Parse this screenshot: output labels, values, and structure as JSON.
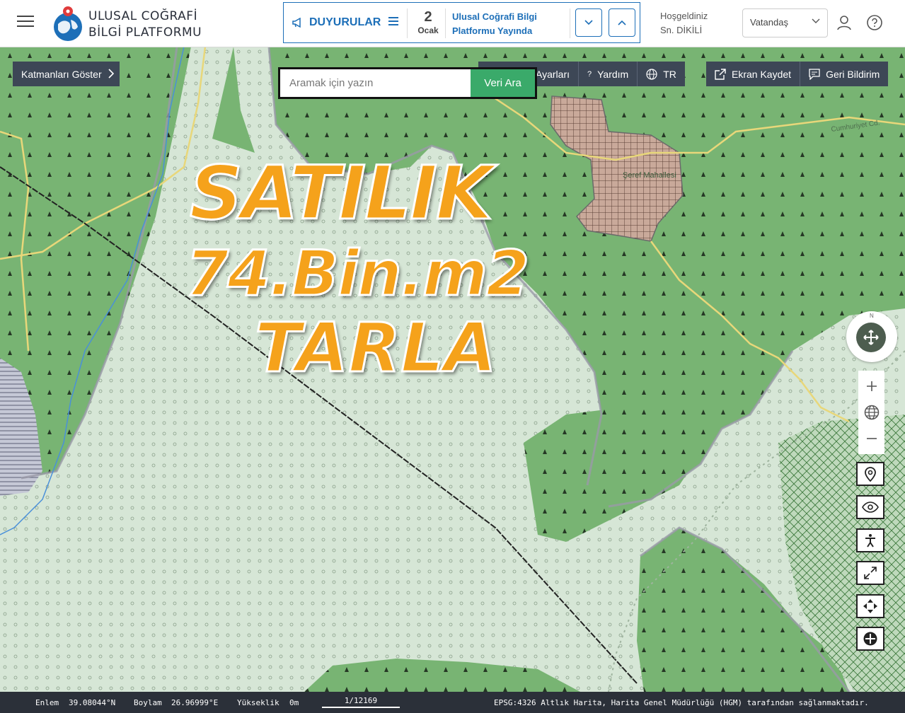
{
  "header": {
    "brand_line1": "ULUSAL COĞRAFİ",
    "brand_line2": "BİLGİ PLATFORMU",
    "announcements": {
      "label": "DUYURULAR",
      "day": "2",
      "month": "Ocak",
      "text_line1": "Ulusal Coğrafi Bilgi",
      "text_line2": "Platformu Yayında"
    },
    "welcome_line1": "Hoşgeldiniz",
    "welcome_line2": "Sn. DİKİLİ",
    "role_selected": "Vatandaş"
  },
  "map_controls": {
    "layers_button": "Katmanları Göster",
    "search_placeholder": "Aramak için yazın",
    "search_button": "Veri Ara",
    "settings_label": "Ayarları",
    "help_label": "Yardım",
    "language_label": "TR",
    "screenshot_label": "Ekran Kaydet",
    "feedback_label": "Geri Bildirim",
    "compass_north": "N"
  },
  "map_labels": {
    "neighborhood": "Şeref Mahallesi",
    "road": "Cumhuriyet Cd."
  },
  "promo": {
    "line1": "SATILIK",
    "line2": "74.Bin.m2",
    "line3": "TARLA"
  },
  "status": {
    "lat_label": "Enlem",
    "lat_value": "39.08044°N",
    "lon_label": "Boylam",
    "lon_value": "26.96999°E",
    "elev_label": "Yükseklik",
    "elev_value": "0m",
    "scale": "1/12169",
    "attribution": "EPSG:4326 Altlık Harita, Harita Genel Müdürlüğü (HGM) tarafından sağlanmaktadır."
  },
  "colors": {
    "forest": "#78b473",
    "open_land": "#d6e6d6",
    "settlement": "#c9a99a",
    "toolbar": "#3d4756",
    "accent_blue": "#1d6fb8",
    "search_green": "#3aaa6a",
    "promo_orange": "#f5a21b"
  }
}
